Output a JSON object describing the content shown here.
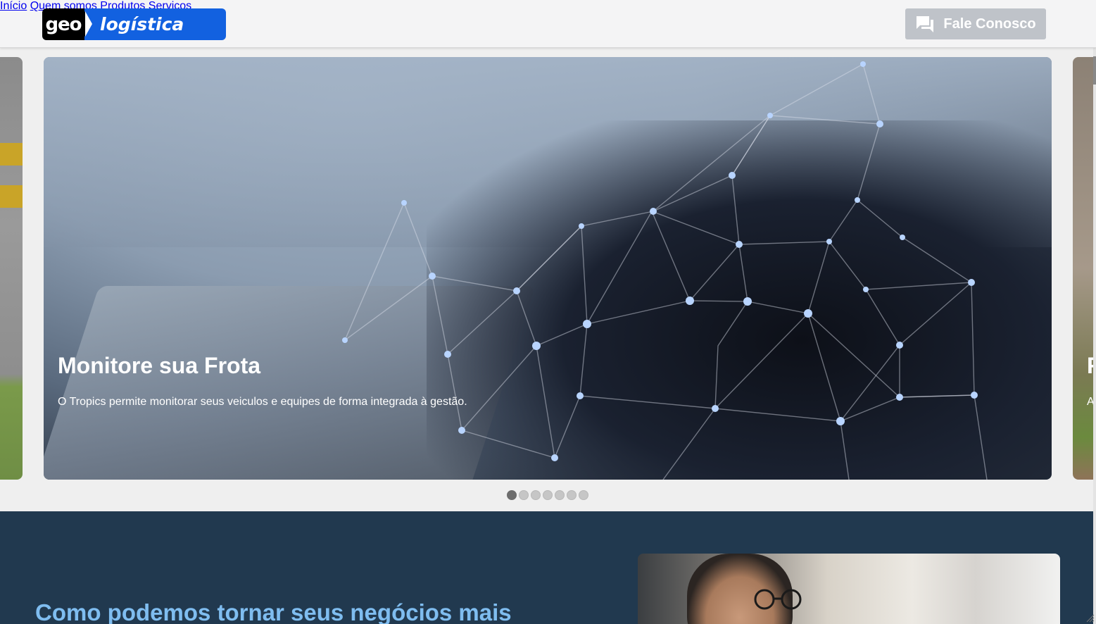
{
  "header": {
    "logo_left": "geo",
    "logo_right": "logística",
    "nav": [
      "Início",
      "Quem somos",
      "Produtos",
      "Serviços"
    ],
    "cta_label": "Fale Conosco",
    "cta_icon": "chat-icon"
  },
  "carousel": {
    "main_title": "Monitore sua Frota",
    "main_text": "O Tropics permite monitorar seus veiculos e equipes de forma integrada à gestão.",
    "next_title_peek": "F",
    "next_text_peek": "A",
    "dots_count": 7,
    "active_dot": 1
  },
  "section": {
    "title": "Como podemos tornar seus negócios mais"
  },
  "colors": {
    "brand_blue": "#1261e0",
    "section_bg": "#21394f",
    "section_title": "#7fbdf0",
    "cta_bg": "#bfc3c9"
  }
}
